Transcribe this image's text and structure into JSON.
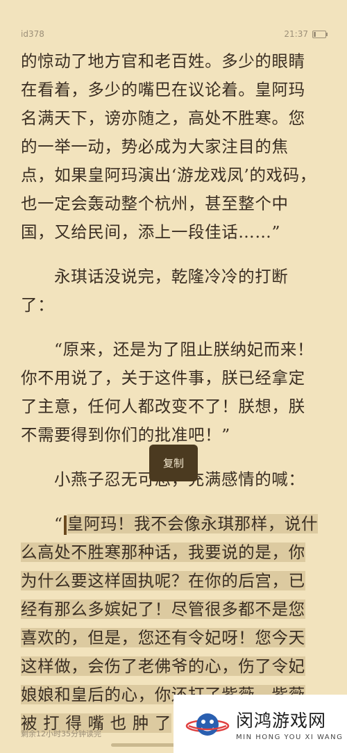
{
  "status": {
    "book_id": "id378",
    "time": "21:37",
    "battery_percent": 20
  },
  "paragraphs": [
    {
      "lines": [
        "的惊动了地方官和老百姓。多少的眼睛",
        "在看着，多少的嘴巴在议论着。皇阿玛",
        "名满天下，谤亦随之，高处不胜寒。您",
        "的一举一动，势必成为大家注目的焦",
        "点，如果皇阿玛演出‘游龙戏凤’的戏码，",
        "也一定会轰动整个杭州，甚至整个中",
        "国，又给民间，添上一段佳话……”"
      ]
    },
    {
      "lines": [
        "永琪话没说完，乾隆冷冷的打断",
        "了："
      ]
    },
    {
      "lines": [
        "“原来，还是为了阻止朕纳妃而来！",
        "你不用说了，关于这件事，朕已经拿定",
        "了主意，任何人都改变不了！朕想，朕",
        "不需要得到你们的批准吧！”"
      ]
    },
    {
      "lines": [
        "小燕子忍无可忍，充满感情的喊："
      ]
    }
  ],
  "selected_paragraph": {
    "first_line_prefix": "“",
    "first_line_rest": "皇阿玛！我不会像永琪那样，说什",
    "lines": [
      "么高处不胜寒那种话，我要说的是，你",
      "为什么要这样固执呢？在你的后宫，已",
      "经有那么多嫔妃了！尽管很多都不是您",
      "喜欢的，但是，您还有令妃呀！您今天",
      "这样做，会伤了老佛爷的心，伤了令妃",
      "娘娘和皇后的心，你还打了紫薇，紫薇",
      "被 打 得 嘴 也 肿 了"
    ]
  },
  "copy_button": {
    "label": "复制"
  },
  "footer": {
    "remaining": "剩余12小时35分钟读完"
  },
  "watermark": {
    "title": "闵鸿游戏网",
    "subtitle": "MIN HONG YOU XI WANG"
  },
  "colors": {
    "background": "#f2e3bd",
    "highlight": "#dccaa0",
    "popup": "#4b3a20"
  }
}
